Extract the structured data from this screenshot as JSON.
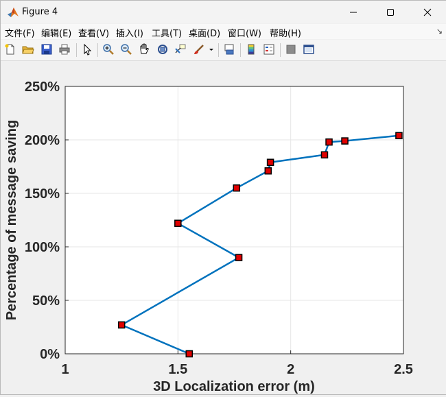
{
  "window": {
    "title": "Figure 4"
  },
  "menu": {
    "items": [
      {
        "label": "文件(F)",
        "name": "menu-file"
      },
      {
        "label": "编辑(E)",
        "name": "menu-edit"
      },
      {
        "label": "查看(V)",
        "name": "menu-view"
      },
      {
        "label": "插入(I)",
        "name": "menu-insert"
      },
      {
        "label": "工具(T)",
        "name": "menu-tools"
      },
      {
        "label": "桌面(D)",
        "name": "menu-desktop"
      },
      {
        "label": "窗口(W)",
        "name": "menu-window"
      },
      {
        "label": "帮助(H)",
        "name": "menu-help"
      }
    ]
  },
  "toolbar": {
    "icons": [
      "new-figure-icon",
      "open-file-icon",
      "save-icon",
      "print-icon",
      "pointer-icon",
      "zoom-in-icon",
      "zoom-out-icon",
      "pan-hand-icon",
      "rotate-3d-icon",
      "data-cursor-icon",
      "brush-icon",
      "brush-dropdown-icon",
      "link-plot-icon",
      "colorbar-icon",
      "legend-icon",
      "hide-plot-tools-icon",
      "show-plot-tools-icon"
    ]
  },
  "colors": {
    "line": "#0072bd",
    "marker_fill": "#e00000",
    "marker_edge": "#000000",
    "grid": "#e6e6e6"
  },
  "chart_data": {
    "type": "line",
    "title": "",
    "xlabel": "3D Localization error (m)",
    "ylabel": "Percentage of message saving",
    "xlim": [
      1,
      2.5
    ],
    "ylim": [
      0,
      250
    ],
    "xticks": [
      1,
      1.5,
      2,
      2.5
    ],
    "xtick_labels": [
      "1",
      "1.5",
      "2",
      "2.5"
    ],
    "yticks": [
      0,
      50,
      100,
      150,
      200,
      250
    ],
    "ytick_labels": [
      "0%",
      "50%",
      "100%",
      "150%",
      "200%",
      "250%"
    ],
    "grid": true,
    "legend": false,
    "series": [
      {
        "x": [
          1.55,
          1.25,
          1.77,
          1.5,
          1.76,
          1.9,
          1.91,
          2.15,
          2.17,
          2.24,
          2.48
        ],
        "y": [
          0,
          27,
          90,
          122,
          155,
          171,
          179,
          186,
          198,
          199,
          204
        ]
      }
    ]
  }
}
